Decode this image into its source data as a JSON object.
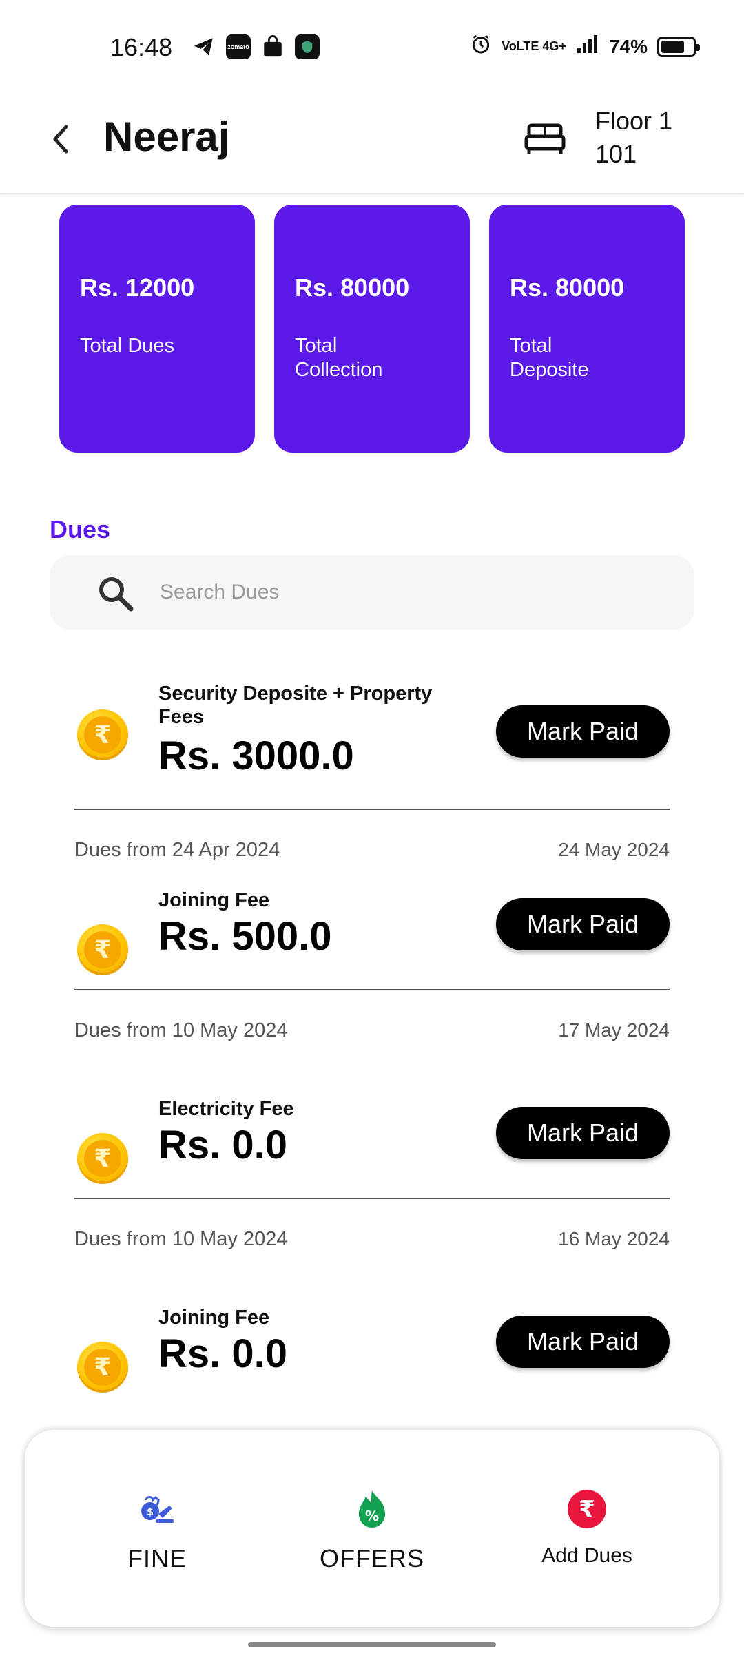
{
  "status_bar": {
    "time": "16:48",
    "apps": [
      "telegram-icon",
      "zomato-icon",
      "shopping-bag-icon",
      "shield-app-icon"
    ],
    "zomato_label": "zomato",
    "network": "VoLTE 4G+",
    "battery": "74%",
    "battery_level": 0.74
  },
  "header": {
    "name": "Neeraj",
    "floor": "Floor 1",
    "room": "101"
  },
  "cards": [
    {
      "amount": "Rs. 12000",
      "label": "Total Dues"
    },
    {
      "amount": "Rs. 80000",
      "label": "Total Collection"
    },
    {
      "amount": "Rs. 80000",
      "label": "Total Deposite"
    }
  ],
  "dues_section": {
    "title": "Dues",
    "search_placeholder": "Search Dues"
  },
  "dues": [
    {
      "title": "Security Deposite + Property Fees",
      "amount": "Rs. 3000.0",
      "button": "Mark Paid",
      "from": "Dues from 24 Apr 2024",
      "date": "24 May 2024"
    },
    {
      "title": "Joining Fee",
      "amount": "Rs. 500.0",
      "button": "Mark Paid",
      "from": "Dues from 10 May 2024",
      "date": "17 May 2024"
    },
    {
      "title": "Electricity Fee",
      "amount": "Rs. 0.0",
      "button": "Mark Paid",
      "from": "Dues from 10 May 2024",
      "date": "16 May 2024"
    },
    {
      "title": "Joining Fee",
      "amount": "Rs. 0.0",
      "button": "Mark Paid"
    }
  ],
  "coin_symbol": "₹",
  "bottom_nav": {
    "fine": "FINE",
    "offers": "OFFERS",
    "add_dues": "Add Dues",
    "offers_symbol": "%",
    "add_dues_symbol": "₹"
  },
  "colors": {
    "accent": "#5b1ae8",
    "button": "#000000",
    "fine_icon": "#3d5bd9",
    "offers_icon": "#12a150",
    "add_dues_icon": "#e8163c"
  }
}
